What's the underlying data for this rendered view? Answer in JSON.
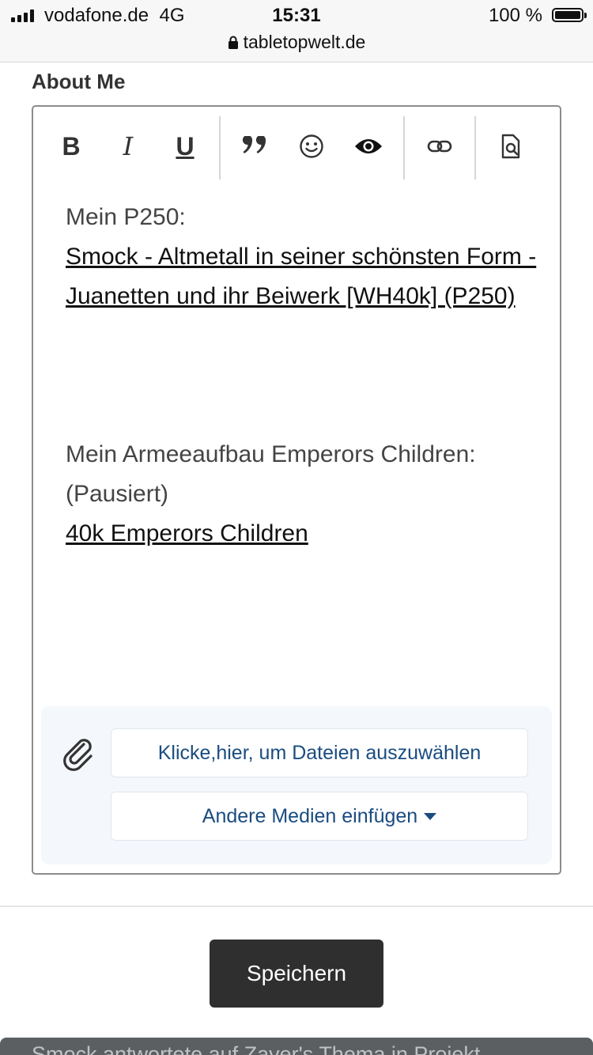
{
  "status_bar": {
    "carrier": "vodafone.de",
    "network": "4G",
    "time": "15:31",
    "battery_percent": "100 %",
    "battery_level": 1.0
  },
  "url_bar": {
    "domain": "tabletopwelt.de",
    "icon": "lock-icon"
  },
  "section": {
    "title": "About Me"
  },
  "toolbar": {
    "bold_label": "B",
    "italic_label": "I",
    "underline_label": "U",
    "icons": [
      "bold-icon",
      "italic-icon",
      "underline-icon",
      "quote-icon",
      "smiley-icon",
      "eye-icon",
      "link-icon",
      "preview-icon"
    ]
  },
  "content": {
    "line1": "Mein P250:",
    "link1": "Smock - Altmetall in seiner schönsten Form - Juanetten und ihr Beiwerk [WH40k] (P250)",
    "line2": "Mein Armeeaufbau Emperors Children:",
    "line3": "(Pausiert)",
    "link2": "40k Emperors Children"
  },
  "attachments": {
    "select_files": "Klicke,hier, um Dateien auszuwählen",
    "other_media": "Andere Medien einfügen",
    "accent_color": "#1a4c80"
  },
  "actions": {
    "save": "Speichern"
  },
  "background_text": "Smock antwortete auf Zaver's Thema in Projekt"
}
